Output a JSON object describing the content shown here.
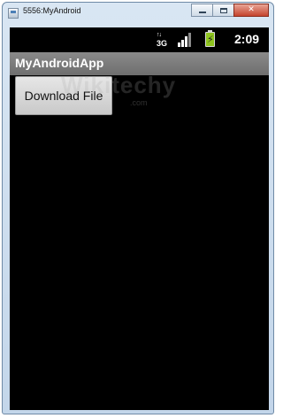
{
  "window": {
    "title": "5556:MyAndroid",
    "close_glyph": "✕"
  },
  "statusbar": {
    "network_label": "3G",
    "network_arrows": "↑↓",
    "clock": "2:09",
    "icons": [
      "network-3g-icon",
      "signal-bars-icon",
      "battery-charging-icon"
    ]
  },
  "app": {
    "title": "MyAndroidApp",
    "download_button_label": "Download File"
  },
  "watermark": {
    "text": "Wikitechy",
    "sub": ".com"
  },
  "colors": {
    "screen_background": "#000000",
    "appbar": "#7c7c7c",
    "battery": "#8fc41f"
  }
}
